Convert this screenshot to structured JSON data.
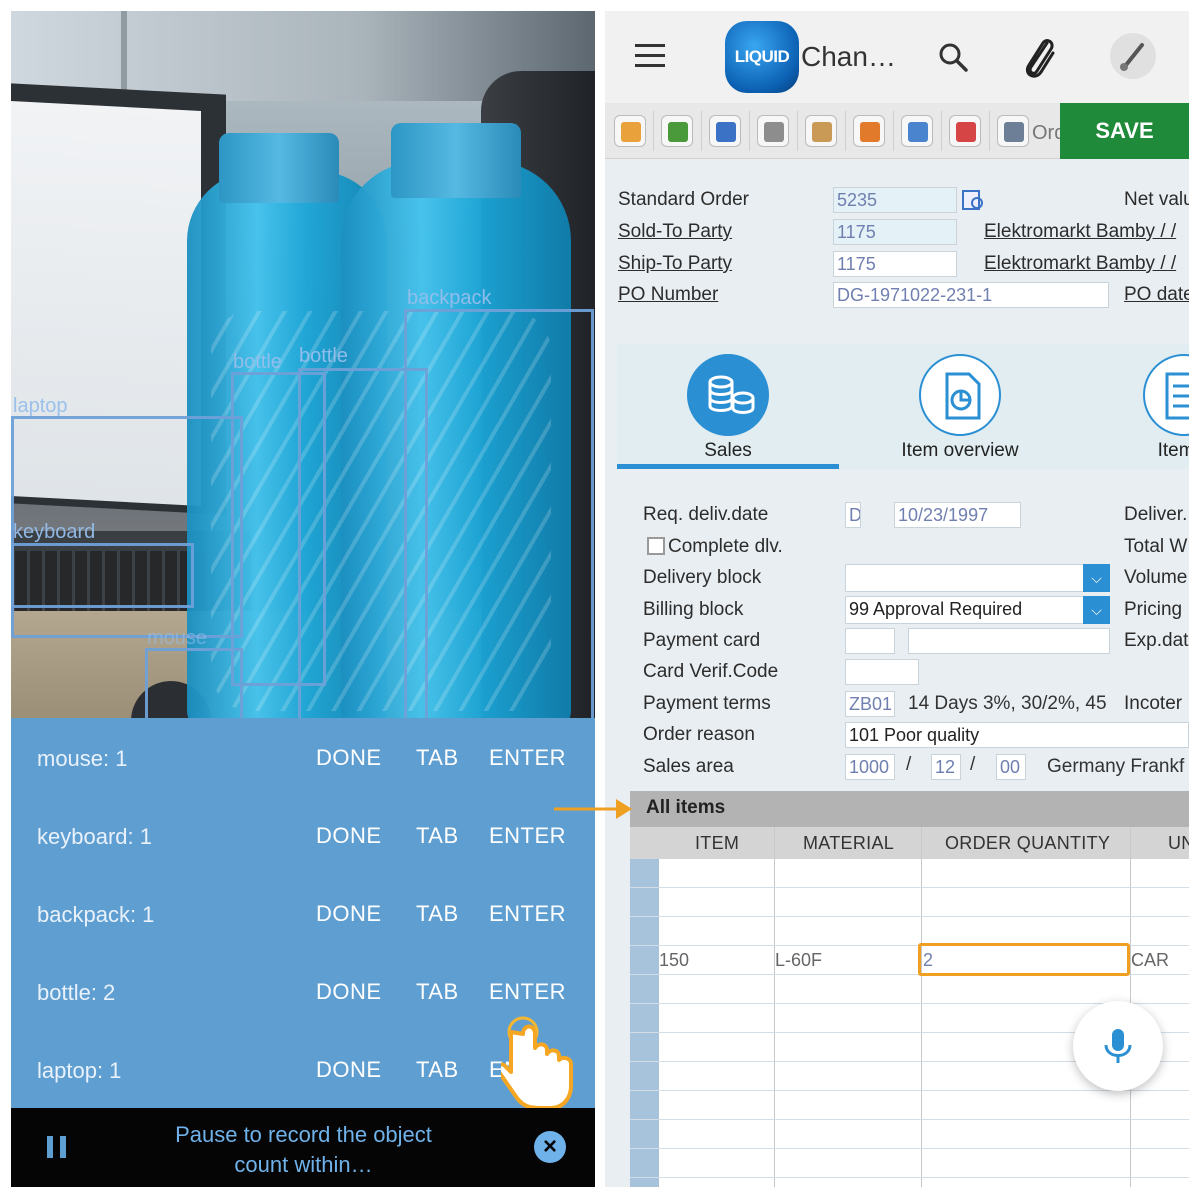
{
  "left": {
    "detections": [
      {
        "label": "backpack"
      },
      {
        "label": "bottle"
      },
      {
        "label": "bottle"
      },
      {
        "label": "laptop"
      },
      {
        "label": "keyboard"
      },
      {
        "label": "mouse"
      }
    ],
    "counts": [
      {
        "label": "mouse: 1",
        "done": "DONE",
        "tab": "TAB",
        "enter": "ENTER"
      },
      {
        "label": "keyboard: 1",
        "done": "DONE",
        "tab": "TAB",
        "enter": "ENTER"
      },
      {
        "label": "backpack: 1",
        "done": "DONE",
        "tab": "TAB",
        "enter": "ENTER"
      },
      {
        "label": "bottle: 2",
        "done": "DONE",
        "tab": "TAB",
        "enter": "ENTER"
      },
      {
        "label": "laptop: 1",
        "done": "DONE",
        "tab": "TAB",
        "enter": "EN"
      }
    ],
    "bottom_bar": {
      "text": "Pause to record the object count within…"
    }
  },
  "right": {
    "app": {
      "logo_text": "LIQUID",
      "title": "Chan…"
    },
    "toolbar": {
      "truncated_label": "Ord",
      "save_label": "SAVE"
    },
    "header_fields": {
      "standard_order": {
        "label": "Standard Order",
        "value": "5235"
      },
      "net_value": {
        "label": "Net valu"
      },
      "sold_to": {
        "label": "Sold-To Party",
        "value": "1175",
        "name": "Elektromarkt Bamby / /"
      },
      "ship_to": {
        "label": "Ship-To Party",
        "value": "1175",
        "name": "Elektromarkt Bamby / /"
      },
      "po_number": {
        "label": "PO Number",
        "value": "DG-1971022-231-1"
      },
      "po_date": {
        "label": "PO date"
      }
    },
    "tabs": [
      {
        "label": "Sales",
        "active": true
      },
      {
        "label": "Item overview",
        "active": false
      },
      {
        "label": "Item d",
        "active": false
      }
    ],
    "sales_fields": {
      "req_deliv_date": {
        "label": "Req. deliv.date",
        "code": "D",
        "value": "10/23/1997"
      },
      "complete_dlv": {
        "label": "Complete dlv."
      },
      "delivery_block": {
        "label": "Delivery block",
        "value": ""
      },
      "billing_block": {
        "label": "Billing block",
        "value": "99  Approval Required"
      },
      "payment_card": {
        "label": "Payment card"
      },
      "card_verif": {
        "label": "Card Verif.Code"
      },
      "payment_terms": {
        "label": "Payment terms",
        "code": "ZB01",
        "text": "14 Days 3%, 30/2%, 45"
      },
      "order_reason": {
        "label": "Order reason",
        "value": "101 Poor quality"
      },
      "sales_area": {
        "label": "Sales area",
        "org": "1000",
        "sep1": "/",
        "channel": "12",
        "sep2": "/",
        "division": "00",
        "text": "Germany Frankf"
      },
      "right_labels": [
        "Deliver.",
        "Total W",
        "Volume",
        "Pricing",
        "Exp.dat",
        "Incoter"
      ]
    },
    "items": {
      "title": "All items",
      "columns": [
        "ITEM",
        "MATERIAL",
        "ORDER QUANTITY",
        "UN"
      ],
      "rows": [
        {
          "item": "150",
          "material": "L-60F",
          "quantity": "2",
          "unit": "CAR"
        }
      ]
    },
    "colors": {
      "accent": "#2b8fd3",
      "save": "#1e8a3a",
      "highlight": "#f0a020",
      "count_panel": "#5f9ed1"
    }
  }
}
